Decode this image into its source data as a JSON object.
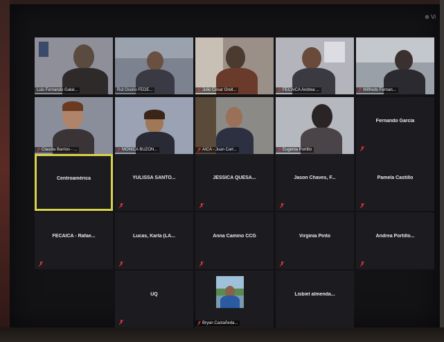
{
  "meeting": {
    "view_label": "⊕ Vi"
  },
  "video_tiles": [
    {
      "name": "Luis Fernando Galal...",
      "muted": false
    },
    {
      "name": "Rut Osorio FEDE...",
      "muted": false
    },
    {
      "name": "Julio César Orell...",
      "muted": true
    },
    {
      "name": "FECAICA Andrea ...",
      "muted": true
    },
    {
      "name": "Wilfredo Fernan...",
      "muted": true
    },
    {
      "name": "Claudia Barrios - ...",
      "muted": true
    },
    {
      "name": "MÓNICA BUZON...",
      "muted": true
    },
    {
      "name": "AICA - Juan Carl...",
      "muted": true
    },
    {
      "name": "Eugenia Portillo",
      "muted": true
    }
  ],
  "name_tiles": [
    {
      "name": "Fernando García",
      "muted": true
    },
    {
      "name": "Centroamérica",
      "muted": false,
      "active": true
    },
    {
      "name": "YULISSA SANTO...",
      "muted": true
    },
    {
      "name": "JESSICA QUESA...",
      "muted": true
    },
    {
      "name": "Jason Chaves, F...",
      "muted": true
    },
    {
      "name": "Pamela Castillo",
      "muted": true
    },
    {
      "name": "FECAICA - Rafae...",
      "muted": true
    },
    {
      "name": "Lucas, Karla (LA...",
      "muted": true
    },
    {
      "name": "Anna Camino CCG",
      "muted": true
    },
    {
      "name": "Virginia Pinto",
      "muted": true
    },
    {
      "name": "Andrea Portillo...",
      "muted": true
    },
    {
      "name": "UQ",
      "muted": true
    },
    {
      "name": "Lisbiel almenda...",
      "muted": false
    }
  ],
  "thumb_tile": {
    "name": "Bryan Castañeda...",
    "muted": true
  },
  "colors": {
    "active_border": "#d8d24a",
    "mute_red": "#e0303a",
    "tile_bg": "#1c1c20"
  }
}
